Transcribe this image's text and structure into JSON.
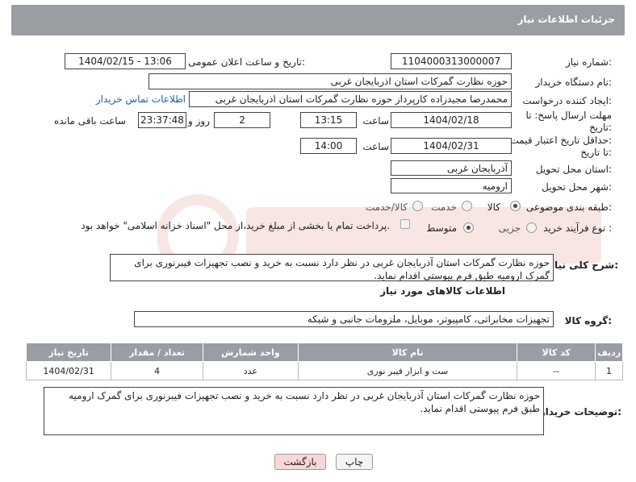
{
  "header": {
    "title": "جزئیات اطلاعات نیاز"
  },
  "fields": {
    "need_number_label": "شماره نیاز:",
    "need_number": "1104000313000007",
    "announce_label": "تاریخ و ساعت اعلان عمومی:",
    "announce_value": "1404/02/15 - 13:06",
    "buyer_org_label": "نام دستگاه خریدار:",
    "buyer_org": "حوزه نظارت گمرکات استان اذربایجان غربی",
    "creator_label": "ایجاد کننده درخواست:",
    "creator": "محمدرضا مجیدزاده کارپرداز حوزه نظارت گمرکات استان اذربایجان غربی",
    "contact_link": "اطلاعات تماس خریدار",
    "reply_deadline_label_1": "مهلت ارسال پاسخ: تا",
    "reply_deadline_label_2": "تاریخ:",
    "reply_date": "1404/02/18",
    "time_label": "ساعت",
    "reply_time": "13:15",
    "days_value": "2",
    "days_label": "روز و",
    "remaining_time": "23:37:48",
    "remaining_label": "ساعت باقی مانده",
    "validity_label_1": "حداقل تاریخ اعتبار قیمت:",
    "validity_label_2": "تا تاریخ:",
    "validity_date": "1404/02/31",
    "validity_time_label": "ساعت",
    "validity_time": "14:00",
    "province_label": "استان محل تحویل:",
    "province": "آذربایجان غربی",
    "city_label": "شهر محل تحویل:",
    "city": "ارومیه",
    "category_label": "طبقه بندی موضوعی:",
    "category_options": [
      "کالا",
      "خدمت",
      "کالا/خدمت"
    ],
    "process_label": "نوع فرآیند خرید :",
    "process_options": [
      "جزیی",
      "متوسط"
    ],
    "payment_note": "پرداخت تمام یا بخشی از مبلغ خرید،از محل \"اسناد خزانه اسلامی\" خواهد بود."
  },
  "description": {
    "label": "شرح کلی نیاز:",
    "text": "حوزه نظارت گمرکات استان آذربایجان غربی در نظر دارد نسبت به خرید و نصب تجهیزات فیبرنوری برای گمرک ارومیه طبق فرم پیوستی اقدام نماید."
  },
  "goods": {
    "section_title": "اطلاعات کالاهای مورد نیاز",
    "group_label": "گروه کالا:",
    "group_value": "تجهیزات مخابراتی، کامپیوتر، موبایل، ملزومات جانبی و شبکه",
    "columns": [
      "ردیف",
      "کد کالا",
      "نام کالا",
      "واحد شمارش",
      "تعداد / مقدار",
      "تاریخ نیاز"
    ],
    "rows": [
      [
        "1",
        "--",
        "ست و ابزار فیبر نوری",
        "عدد",
        "4",
        "1404/02/31"
      ]
    ]
  },
  "buyer_notes": {
    "label": "توضیحات خریدار:",
    "text": "حوزه نظارت گمرکات استان آذربایجان غربی در نظر دارد نسبت به خرید و نصب تجهیزات فیبرنوری برای گمرک ارومیه طبق فرم پیوستی اقدام نماید."
  },
  "buttons": {
    "print": "چاپ",
    "back": "بازگشت"
  },
  "colors": {
    "header_bg": "#9a9ea3",
    "link": "#1a5fb4",
    "back_button_bg": "#f8d7d7"
  }
}
